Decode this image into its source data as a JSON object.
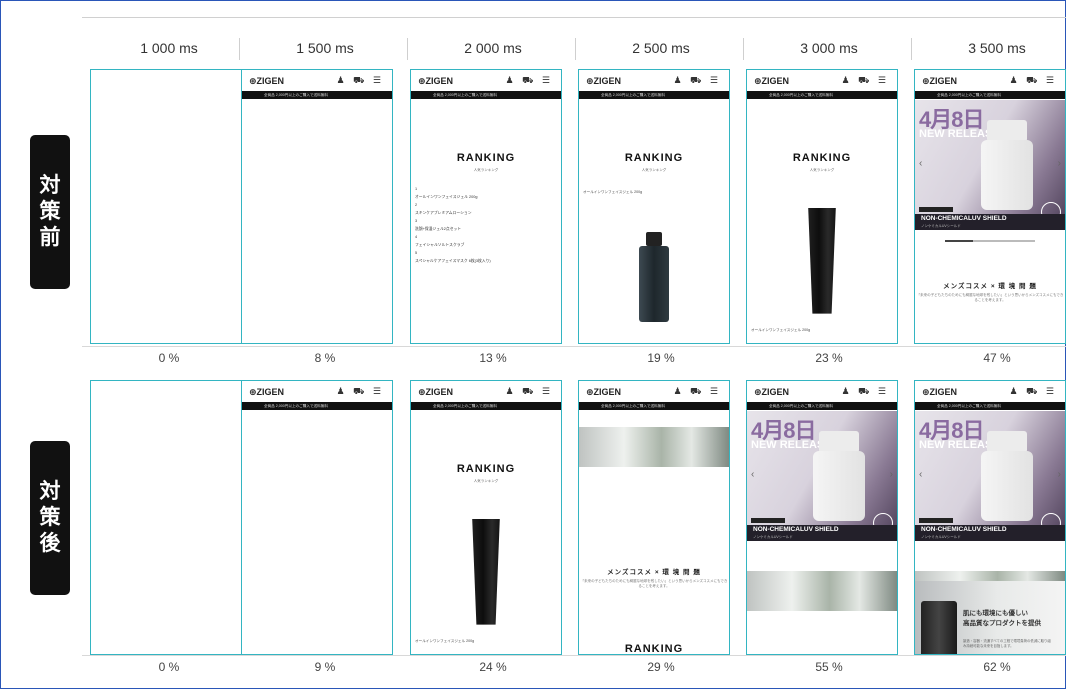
{
  "columns": [
    "1 000 ms",
    "1 500 ms",
    "2 000 ms",
    "2 500 ms",
    "3 000 ms",
    "3 500 ms"
  ],
  "rows": [
    {
      "label": "対策前",
      "percents": [
        "0 %",
        "8 %",
        "13 %",
        "19 %",
        "23 %",
        "47 %"
      ]
    },
    {
      "label": "対策後",
      "percents": [
        "0 %",
        "9 %",
        "24 %",
        "29 %",
        "55 %",
        "62 %"
      ]
    }
  ],
  "screen": {
    "logo": "ZIGEN",
    "icons": "♟ ⛟ ☰",
    "banner": "全商品 2,000円以上のご購入で送料無料",
    "ranking": "RANKING",
    "ranking_sub": "人気ランキング",
    "ranking_list": [
      "1",
      "オールインワンフェイスジェル 200g",
      "2",
      "スキンケアプレミアムローション",
      "3",
      "洗顔+保湿ジェル2点セット",
      "4",
      "フェイシャルソルトスクラブ",
      "5",
      "スペシャルケアフェイスマスク 6枚(3枚入り)"
    ],
    "ranking_one": "オールインワンフェイスジェル 200g",
    "hero_date": "4月8日",
    "hero_release": "NEW RELEASE",
    "hero_product": "NON-CHEMICALUV SHIELD",
    "hero_product_sub": "ノンケミカルUVシールド",
    "msg_title": "メンズコスメ × 環 境 問 題",
    "msg_sub": "「未来の子どもたちのためにも綺麗な地球を残したい」という思いからメンズコスメにもできることを考えます。",
    "eco_title": "肌にも環境にも優しい\n高品質なプロダクトを提供",
    "eco_sub": "製造・容器・流通すべての工程で環境負荷の低減に取り組み持続可能な未来を目指します。"
  }
}
